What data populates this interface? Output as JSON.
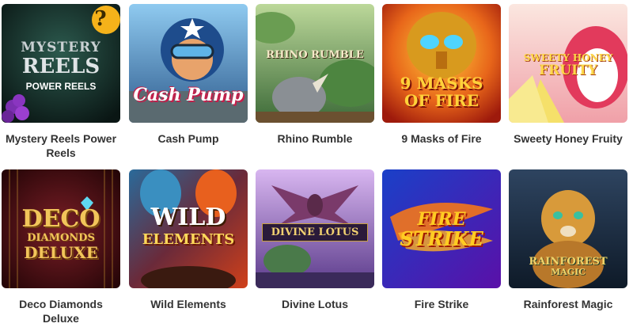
{
  "games": [
    {
      "title": "Mystery Reels Power Reels",
      "logo_lines": [
        "MYSTERY",
        "REELS",
        "POWER REELS"
      ],
      "badge": "?",
      "colors": {
        "bg1": "#1f3b35",
        "bg2": "#0d1a18",
        "text": "#c9d0d2"
      }
    },
    {
      "title": "Cash Pump",
      "logo_lines": [
        "Cash Pump"
      ],
      "colors": {
        "bg1": "#7fc1ea",
        "bg2": "#3b6fa8",
        "text": "#ffffff",
        "accent": "#d8234f"
      }
    },
    {
      "title": "Rhino Rumble",
      "logo_lines": [
        "RHINO RUMBLE"
      ],
      "colors": {
        "bg1": "#9fc47a",
        "bg2": "#3f6b3a",
        "text": "#f5e9c8"
      }
    },
    {
      "title": "9 Masks of Fire",
      "logo_lines": [
        "9 MASKS",
        "OF FIRE"
      ],
      "colors": {
        "bg1": "#f4a21a",
        "bg2": "#b3250e",
        "text": "#ffd23a"
      }
    },
    {
      "title": "Sweety Honey Fruity",
      "logo_lines": [
        "SWEETY HONEY",
        "FRUITY"
      ],
      "colors": {
        "bg1": "#f5d7d0",
        "bg2": "#e25a6f",
        "text": "#ffd84a"
      }
    },
    {
      "title": "Deco Diamonds Deluxe",
      "logo_lines": [
        "DECO",
        "DIAMONDS",
        "DELUXE"
      ],
      "colors": {
        "bg1": "#6a1820",
        "bg2": "#2a0508",
        "text": "#f2c55a"
      }
    },
    {
      "title": "Wild Elements",
      "logo_lines": [
        "WILD",
        "ELEMENTS"
      ],
      "colors": {
        "bg1": "#2f5f86",
        "bg2": "#b0281b",
        "text": "#ffd95a"
      }
    },
    {
      "title": "Divine Lotus",
      "logo_lines": [
        "DIVINE LOTUS"
      ],
      "colors": {
        "bg1": "#c8a3e6",
        "bg2": "#5a3a8a",
        "text": "#f0d070"
      }
    },
    {
      "title": "Fire Strike",
      "logo_lines": [
        "FIRE",
        "STRIKE"
      ],
      "colors": {
        "bg1": "#1c3fb8",
        "bg2": "#5a14a8",
        "text": "#ffcc22"
      }
    },
    {
      "title": "Rainforest Magic",
      "logo_lines": [
        "RAINFOREST",
        "MAGIC"
      ],
      "colors": {
        "bg1": "#26384e",
        "bg2": "#122030",
        "text": "#f0d46a"
      }
    }
  ]
}
